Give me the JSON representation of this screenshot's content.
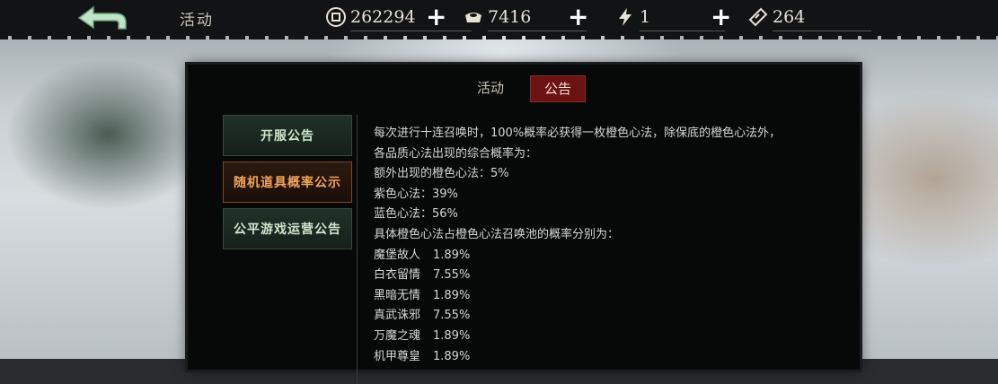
{
  "header": {
    "title": "活动",
    "resources": [
      {
        "icon": "coin-icon",
        "value": "262294"
      },
      {
        "icon": "ingot-icon",
        "value": "7416"
      },
      {
        "icon": "energy-icon",
        "value": "1"
      },
      {
        "icon": "ticket-icon",
        "value": "264"
      }
    ],
    "plus": "+"
  },
  "panel": {
    "tabs": {
      "activity": "活动",
      "notice": "公告"
    },
    "side": [
      "开服公告",
      "随机道具概率公示",
      "公平游戏运营公告"
    ],
    "lines": [
      "每次进行十连召唤时，100%概率必获得一枚橙色心法，除保底的橙色心法外，",
      "各品质心法出现的综合概率为：",
      "额外出现的橙色心法：5%",
      "紫色心法：39%",
      "蓝色心法：56%",
      "具体橙色心法占橙色心法召唤池的概率分别为："
    ],
    "rates": [
      {
        "name": "魔堡故人",
        "rate": "1.89%"
      },
      {
        "name": "白衣留情",
        "rate": "7.55%"
      },
      {
        "name": "黑暗无情",
        "rate": "1.89%"
      },
      {
        "name": "真武诛邪",
        "rate": "7.55%"
      },
      {
        "name": "万魔之魂",
        "rate": "1.89%"
      },
      {
        "name": "机甲尊皇",
        "rate": "1.89%"
      }
    ]
  },
  "colors": {
    "accent_tab": "#6b1212",
    "selected_item": "#f2a45c"
  }
}
